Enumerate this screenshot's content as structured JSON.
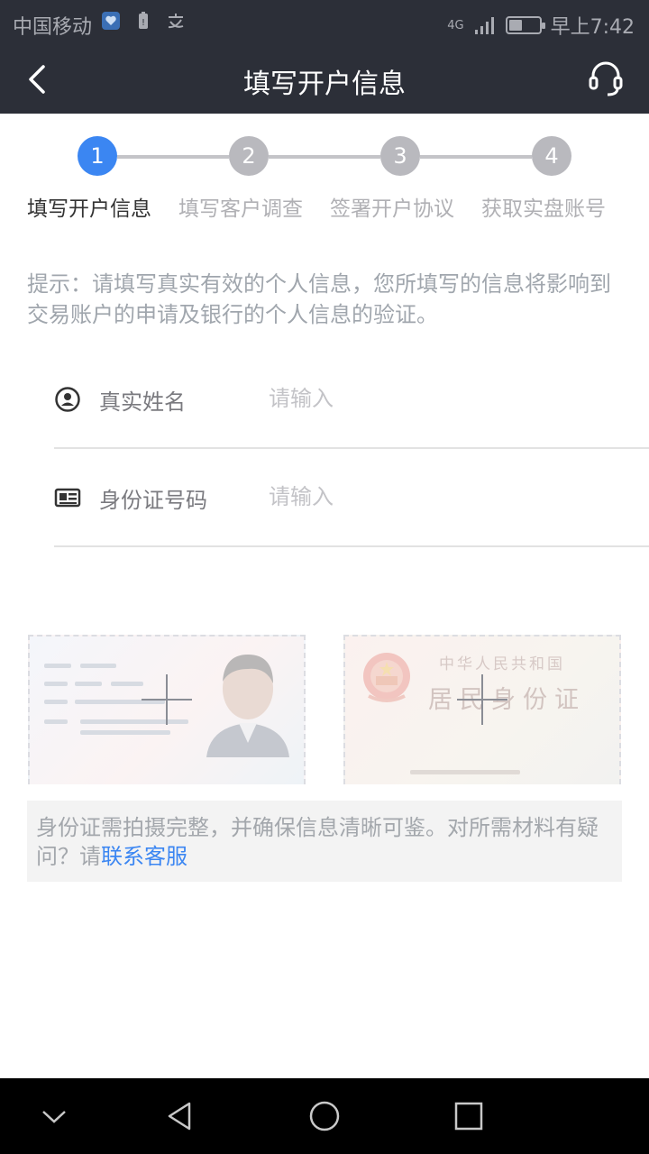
{
  "status_bar": {
    "carrier": "中国移动",
    "network": "4G",
    "time": "早上7:42",
    "battery_level": 0.45
  },
  "nav": {
    "title": "填写开户信息"
  },
  "steps": [
    {
      "number": "1",
      "label": "填写开户信息",
      "active": true
    },
    {
      "number": "2",
      "label": "填写客户调查",
      "active": false
    },
    {
      "number": "3",
      "label": "签署开户协议",
      "active": false
    },
    {
      "number": "4",
      "label": "获取实盘账号",
      "active": false
    }
  ],
  "tip": "提示：请填写真实有效的个人信息，您所填写的信息将影响到交易账户的申请及银行的个人信息的验证。",
  "form": {
    "name": {
      "label": "真实姓名",
      "placeholder": "请输入"
    },
    "id_number": {
      "label": "身份证号码",
      "placeholder": "请输入"
    }
  },
  "id_back_card": {
    "line1": "中华人民共和国",
    "line2": "居民身份证"
  },
  "note": {
    "text": "身份证需拍摄完整，并确保信息清晰可鉴。对所需材料有疑问？请",
    "link": "联系客服"
  },
  "colors": {
    "accent": "#3b86f2",
    "header_bg": "#2c2f38"
  }
}
